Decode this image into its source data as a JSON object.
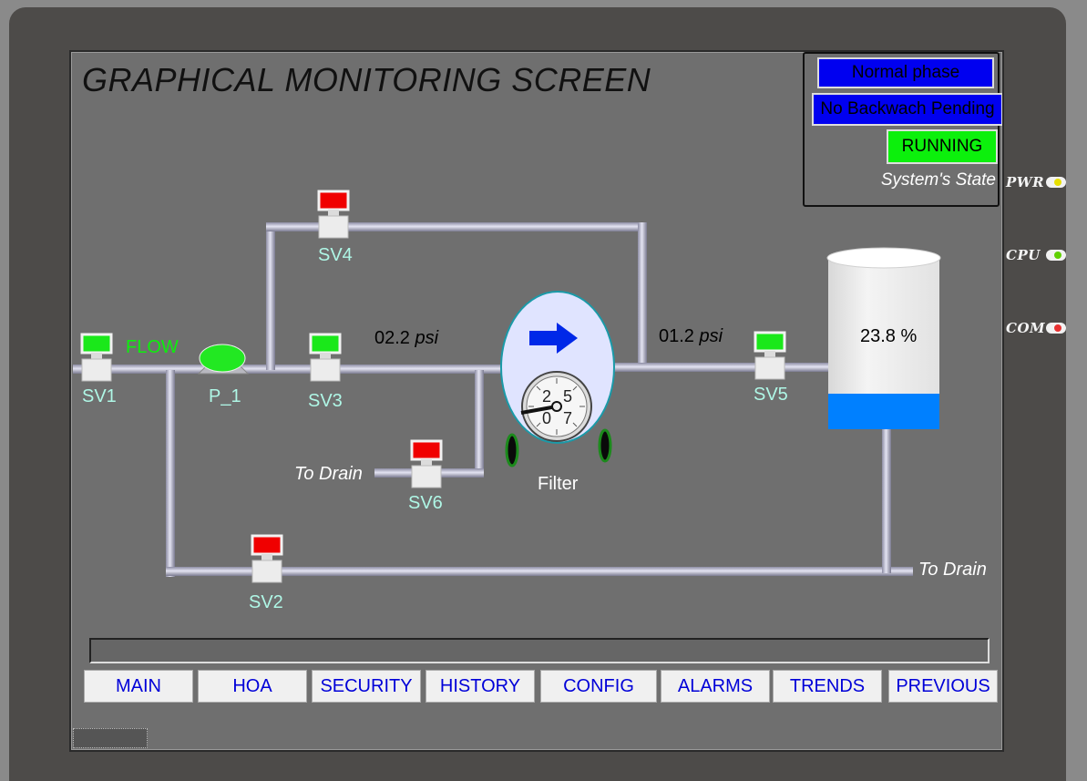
{
  "screen": {
    "title": "GRAPHICAL MONITORING SCREEN"
  },
  "status": {
    "phase": "Normal phase",
    "backwash": "No Backwach Pending",
    "run_state": "RUNNING",
    "label": "System's State"
  },
  "process": {
    "flow_label": "FLOW",
    "pump": "P_1",
    "filter": "Filter",
    "pressure_in": "02.2",
    "pressure_out": "01.2",
    "pressure_unit": "psi",
    "drain_1": "To Drain",
    "drain_2": "To Drain",
    "tank_level_text": "23.8",
    "tank_level_unit": "%",
    "tank_level_fraction": 0.238,
    "gauge_ticks": [
      "2",
      "5",
      "0",
      "7"
    ],
    "valves": [
      {
        "id": "sv1",
        "label": "SV1",
        "state": "open"
      },
      {
        "id": "sv2",
        "label": "SV2",
        "state": "closed"
      },
      {
        "id": "sv3",
        "label": "SV3",
        "state": "open"
      },
      {
        "id": "sv4",
        "label": "SV4",
        "state": "closed"
      },
      {
        "id": "sv5",
        "label": "SV5",
        "state": "open"
      },
      {
        "id": "sv6",
        "label": "SV6",
        "state": "closed"
      }
    ]
  },
  "nav": {
    "main": "MAIN",
    "hoa": "HOA",
    "security": "SECURITY",
    "history": "HISTORY",
    "config": "CONFIG",
    "alarms": "ALARMS",
    "trends": "TRENDS",
    "previous": "PREVIOUS"
  },
  "device": {
    "pwr": "PWR",
    "cpu": "CPU",
    "com": "COM"
  },
  "colors": {
    "open": "#0cf00c",
    "closed": "#f00000",
    "status_blue": "#0000f0",
    "tank_fill": "#0080ff",
    "label_cyan": "#aff7e6"
  },
  "icons": [
    "flow-direction-arrow-icon",
    "pressure-gauge-icon",
    "pump-icon"
  ]
}
